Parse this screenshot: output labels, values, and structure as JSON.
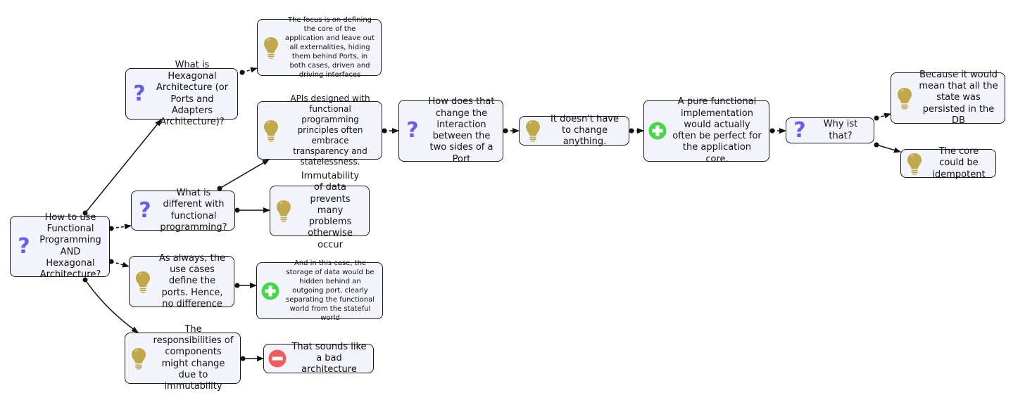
{
  "diagram": {
    "title": "How to use Functional Programming AND Hexagonal Architecture?",
    "colors": {
      "node_fill": "#f3f4fb",
      "node_border": "#1a1a1a",
      "question_icon": "#6b5cf0",
      "idea_icon": "#bfa94a",
      "pro_icon": "#45d64a",
      "con_icon": "#ee5c5c"
    },
    "nodes": [
      {
        "id": "root",
        "type": "question",
        "icon": "question-icon",
        "text": "How to use Functional Programming AND Hexagonal Architecture?"
      },
      {
        "id": "hexarch",
        "type": "question",
        "icon": "question-icon",
        "text": "What is Hexagonal Architecture (or Ports and Adapters Architecture)?"
      },
      {
        "id": "focus",
        "type": "idea",
        "icon": "lightbulb-icon",
        "text": "The focus is on defining the core of the application and leave out all externalities, hiding them behind Ports, in both cases, driven and driving interfaces"
      },
      {
        "id": "different",
        "type": "question",
        "icon": "question-icon",
        "text": "What is different with functional programming?"
      },
      {
        "id": "apis",
        "type": "idea",
        "icon": "lightbulb-icon",
        "text": "APIs designed with functional programming principles often embrace transparency and statelessness."
      },
      {
        "id": "immut",
        "type": "idea",
        "icon": "lightbulb-icon",
        "text": "Immutability of data prevents many problems otherwise occur"
      },
      {
        "id": "interaction",
        "type": "question",
        "icon": "question-icon",
        "text": "How does that change the interaction between the two sides of a Port"
      },
      {
        "id": "nochange",
        "type": "idea",
        "icon": "lightbulb-icon",
        "text": "It doesn't have to change anything."
      },
      {
        "id": "pure",
        "type": "pro",
        "icon": "plus-circle-icon",
        "text": "A pure functional implementation would actually often be perfect for the application core."
      },
      {
        "id": "why",
        "type": "question",
        "icon": "question-icon",
        "text": "Why ist that?"
      },
      {
        "id": "because",
        "type": "idea",
        "icon": "lightbulb-icon",
        "text": "Because it would mean that all the state was persisted in the DB"
      },
      {
        "id": "idempotent",
        "type": "idea",
        "icon": "lightbulb-icon",
        "text": "The core could be idempotent"
      },
      {
        "id": "usecases",
        "type": "idea",
        "icon": "lightbulb-icon",
        "text": "As always, the use cases define the ports. Hence, no difference"
      },
      {
        "id": "storage",
        "type": "pro",
        "icon": "plus-circle-icon",
        "text": "And in this case, the storage of data would be hidden behind an outgoing port, clearly separating the functional world from the stateful world"
      },
      {
        "id": "resp",
        "type": "idea",
        "icon": "lightbulb-icon",
        "text": "The responsibilities of components might change due to immutability"
      },
      {
        "id": "bad",
        "type": "con",
        "icon": "minus-circle-icon",
        "text": "That sounds like a bad architecture"
      }
    ],
    "edges": [
      {
        "from": "root",
        "to": "hexarch",
        "style": "solid"
      },
      {
        "from": "root",
        "to": "different",
        "style": "dashed"
      },
      {
        "from": "root",
        "to": "usecases",
        "style": "dashed"
      },
      {
        "from": "root",
        "to": "resp",
        "style": "solid"
      },
      {
        "from": "hexarch",
        "to": "focus",
        "style": "dashed"
      },
      {
        "from": "different",
        "to": "apis",
        "style": "solid"
      },
      {
        "from": "different",
        "to": "immut",
        "style": "solid"
      },
      {
        "from": "apis",
        "to": "interaction",
        "style": "dashed"
      },
      {
        "from": "interaction",
        "to": "nochange",
        "style": "dashed"
      },
      {
        "from": "nochange",
        "to": "pure",
        "style": "dashed"
      },
      {
        "from": "pure",
        "to": "why",
        "style": "dashed"
      },
      {
        "from": "why",
        "to": "because",
        "style": "dashed"
      },
      {
        "from": "why",
        "to": "idempotent",
        "style": "solid"
      },
      {
        "from": "usecases",
        "to": "storage",
        "style": "solid"
      },
      {
        "from": "resp",
        "to": "bad",
        "style": "solid"
      }
    ]
  }
}
